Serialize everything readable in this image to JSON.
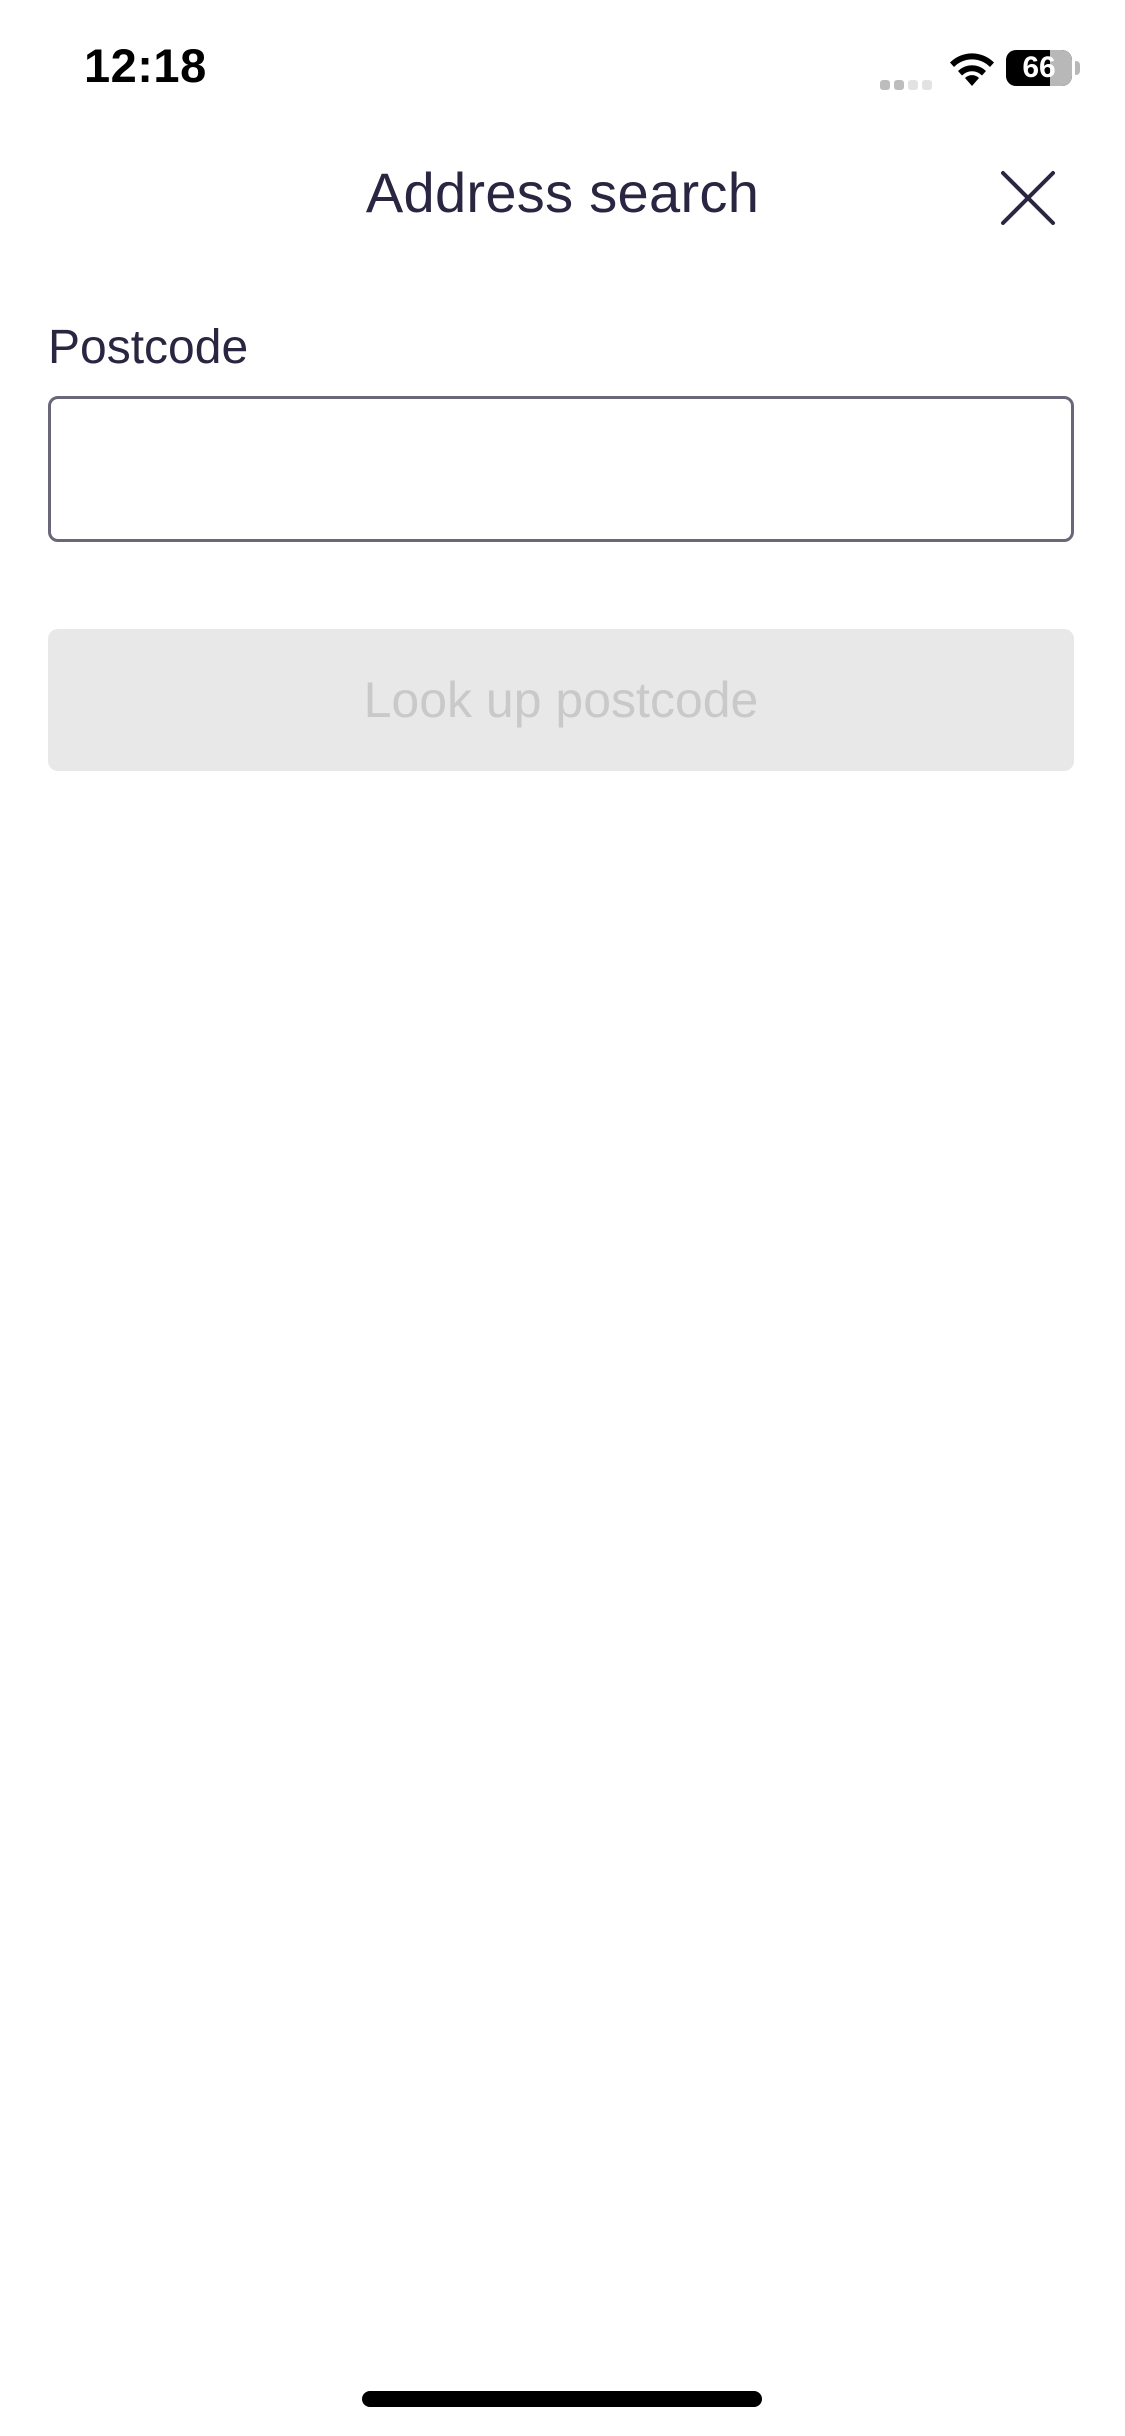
{
  "status_bar": {
    "time": "12:18",
    "battery_level": "66",
    "battery_fraction": 0.66
  },
  "header": {
    "title": "Address search",
    "close_icon": "close-icon"
  },
  "form": {
    "postcode_label": "Postcode",
    "postcode_value": "",
    "postcode_placeholder": "",
    "lookup_button_label": "Look up postcode",
    "lookup_button_disabled": true
  },
  "colors": {
    "text": "#2a2540",
    "input_border": "#6b6778",
    "button_disabled_bg": "#e8e8e8",
    "button_disabled_text": "#c9c9c9"
  },
  "icons": {
    "signal": "cellular-signal-icon",
    "wifi": "wifi-icon",
    "battery": "battery-icon",
    "close": "close-icon"
  }
}
